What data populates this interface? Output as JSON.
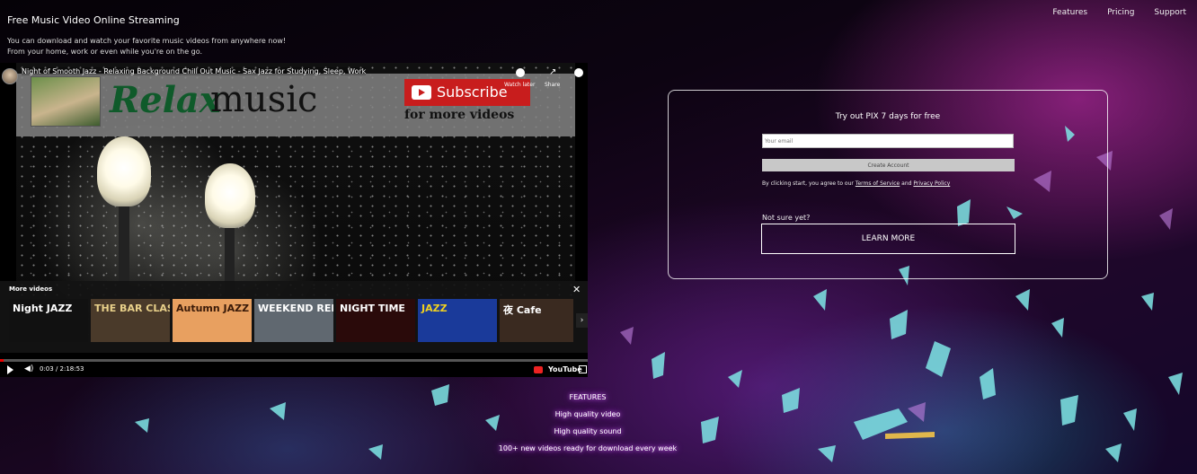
{
  "header": {
    "site_title": "Free Music Video Online Streaming",
    "tagline_line1": "You can download and watch your favorite music videos from anywhere now!",
    "tagline_line2": "From your home, work or even while you're on the go."
  },
  "nav": {
    "items": [
      "Features",
      "Pricing",
      "Support"
    ]
  },
  "video": {
    "title": "Night of Smooth Jazz - Relaxing Background Chill Out Music - Sax Jazz for Studying, Sleep, Work",
    "watch_later": "Watch later",
    "share": "Share",
    "banner_relax": "Relax",
    "banner_music": "music",
    "banner_subscribe": "Subscribe",
    "banner_more": "for more videos",
    "more_videos_label": "More videos",
    "thumbnails": [
      {
        "text": "Night JAZZ",
        "bg": "#111111",
        "fg": "#ffffff"
      },
      {
        "text": "THE BAR CLASSICS",
        "bg": "#4a3a2a",
        "fg": "#e8d08a"
      },
      {
        "text": "Autumn JAZZ",
        "bg": "#e8a060",
        "fg": "#3a1a08"
      },
      {
        "text": "WEEKEND RELAXATION",
        "bg": "#606870",
        "fg": "#ffffff"
      },
      {
        "text": "NIGHT TIME",
        "bg": "#2a0a0a",
        "fg": "#ffffff"
      },
      {
        "text": "JAZZ",
        "bg": "#1a3a9a",
        "fg": "#f0d020"
      },
      {
        "text": "夜 Cafe",
        "bg": "#3a2a20",
        "fg": "#ffffff"
      }
    ],
    "time": "0:03 / 2:18:53",
    "progress": 0.0004,
    "youtube_label": "YouTube"
  },
  "signup": {
    "heading": "Try out PIX 7 days for free",
    "email_placeholder": "Your email",
    "create_button": "Create Account",
    "terms_prefix": "By clicking start, you agree to our",
    "terms_link": "Terms of Service",
    "terms_and": "and",
    "privacy_link": "Privacy Policy",
    "not_sure": "Not sure yet?",
    "learn_more": "LEARN MORE"
  },
  "features": {
    "heading": "FEATURES",
    "items": [
      "High quality video",
      "High quality sound",
      "100+ new videos ready for download every week"
    ]
  },
  "colors": {
    "accent_glow": "#c060ff",
    "shard": "#7fe6e6",
    "yt_red": "#ff0000"
  }
}
